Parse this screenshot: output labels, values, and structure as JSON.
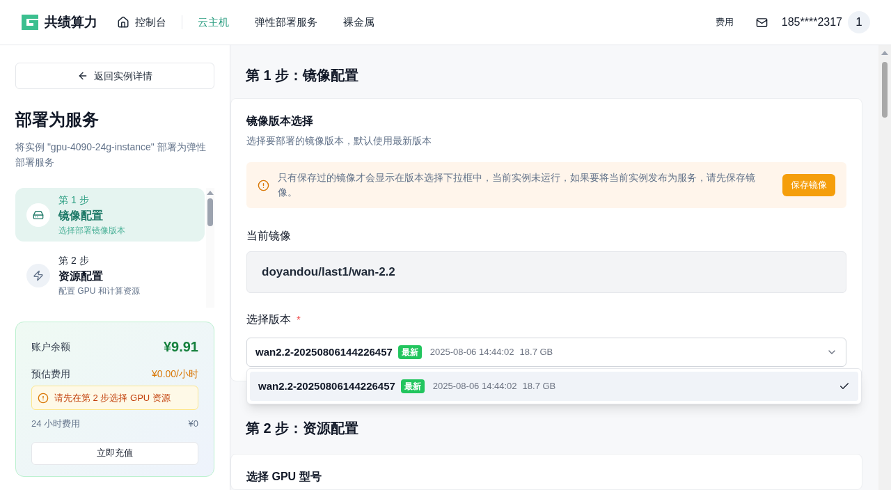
{
  "header": {
    "brand": "共绩算力",
    "nav": [
      {
        "label": "控制台",
        "kind": "home",
        "selected": false
      },
      {
        "label": "云主机",
        "kind": "plain",
        "selected": true
      },
      {
        "label": "弹性部署服务",
        "kind": "plain",
        "selected": false
      },
      {
        "label": "裸金属",
        "kind": "plain",
        "selected": false
      }
    ],
    "fee": "费用",
    "user": "185****2317",
    "avatar": "1"
  },
  "sidebar": {
    "back": "返回实例详情",
    "title": "部署为服务",
    "subtitle": "将实例 \"gpu-4090-24g-instance\" 部署为弹性部署服务",
    "steps": [
      {
        "step": "第 1 步",
        "title": "镜像配置",
        "desc": "选择部署镜像版本",
        "kind": "drive",
        "selected": true
      },
      {
        "step": "第 2 步",
        "title": "资源配置",
        "desc": "配置 GPU 和计算资源",
        "kind": "zap",
        "selected": false
      }
    ],
    "balance": {
      "label": "账户余额",
      "value": "¥9.91",
      "estimate_label": "预估费用",
      "estimate_value": "¥0.00/小时",
      "warning": "请先在第 2 步选择 GPU 资源",
      "day_label": "24 小时费用",
      "day_value": "¥0",
      "recharge": "立即充值"
    }
  },
  "main": {
    "step1_heading": "第 1 步：镜像配置",
    "card_title": "镜像版本选择",
    "card_desc": "选择要部署的镜像版本，默认使用最新版本",
    "notice": "只有保存过的镜像才会显示在版本选择下拉框中，当前实例未运行，如果要将当前实例发布为服务，请先保存镜像。",
    "notice_button": "保存镜像",
    "current_label": "当前镜像",
    "current_value": "doyandou/last1/wan-2.2",
    "version_label": "选择版本",
    "required_mark": "*",
    "select": {
      "name": "wan2.2-20250806144226457",
      "badge": "最新",
      "date": "2025-08-06 14:44:02",
      "size": "18.7 GB",
      "expanded": true
    },
    "options": [
      {
        "name": "wan2.2-20250806144226457",
        "badge": "最新",
        "date": "2025-08-06 14:44:02",
        "size": "18.7 GB",
        "selected": true
      }
    ],
    "step2_heading": "第 2 步：资源配置",
    "gpu_title": "选择 GPU 型号"
  }
}
